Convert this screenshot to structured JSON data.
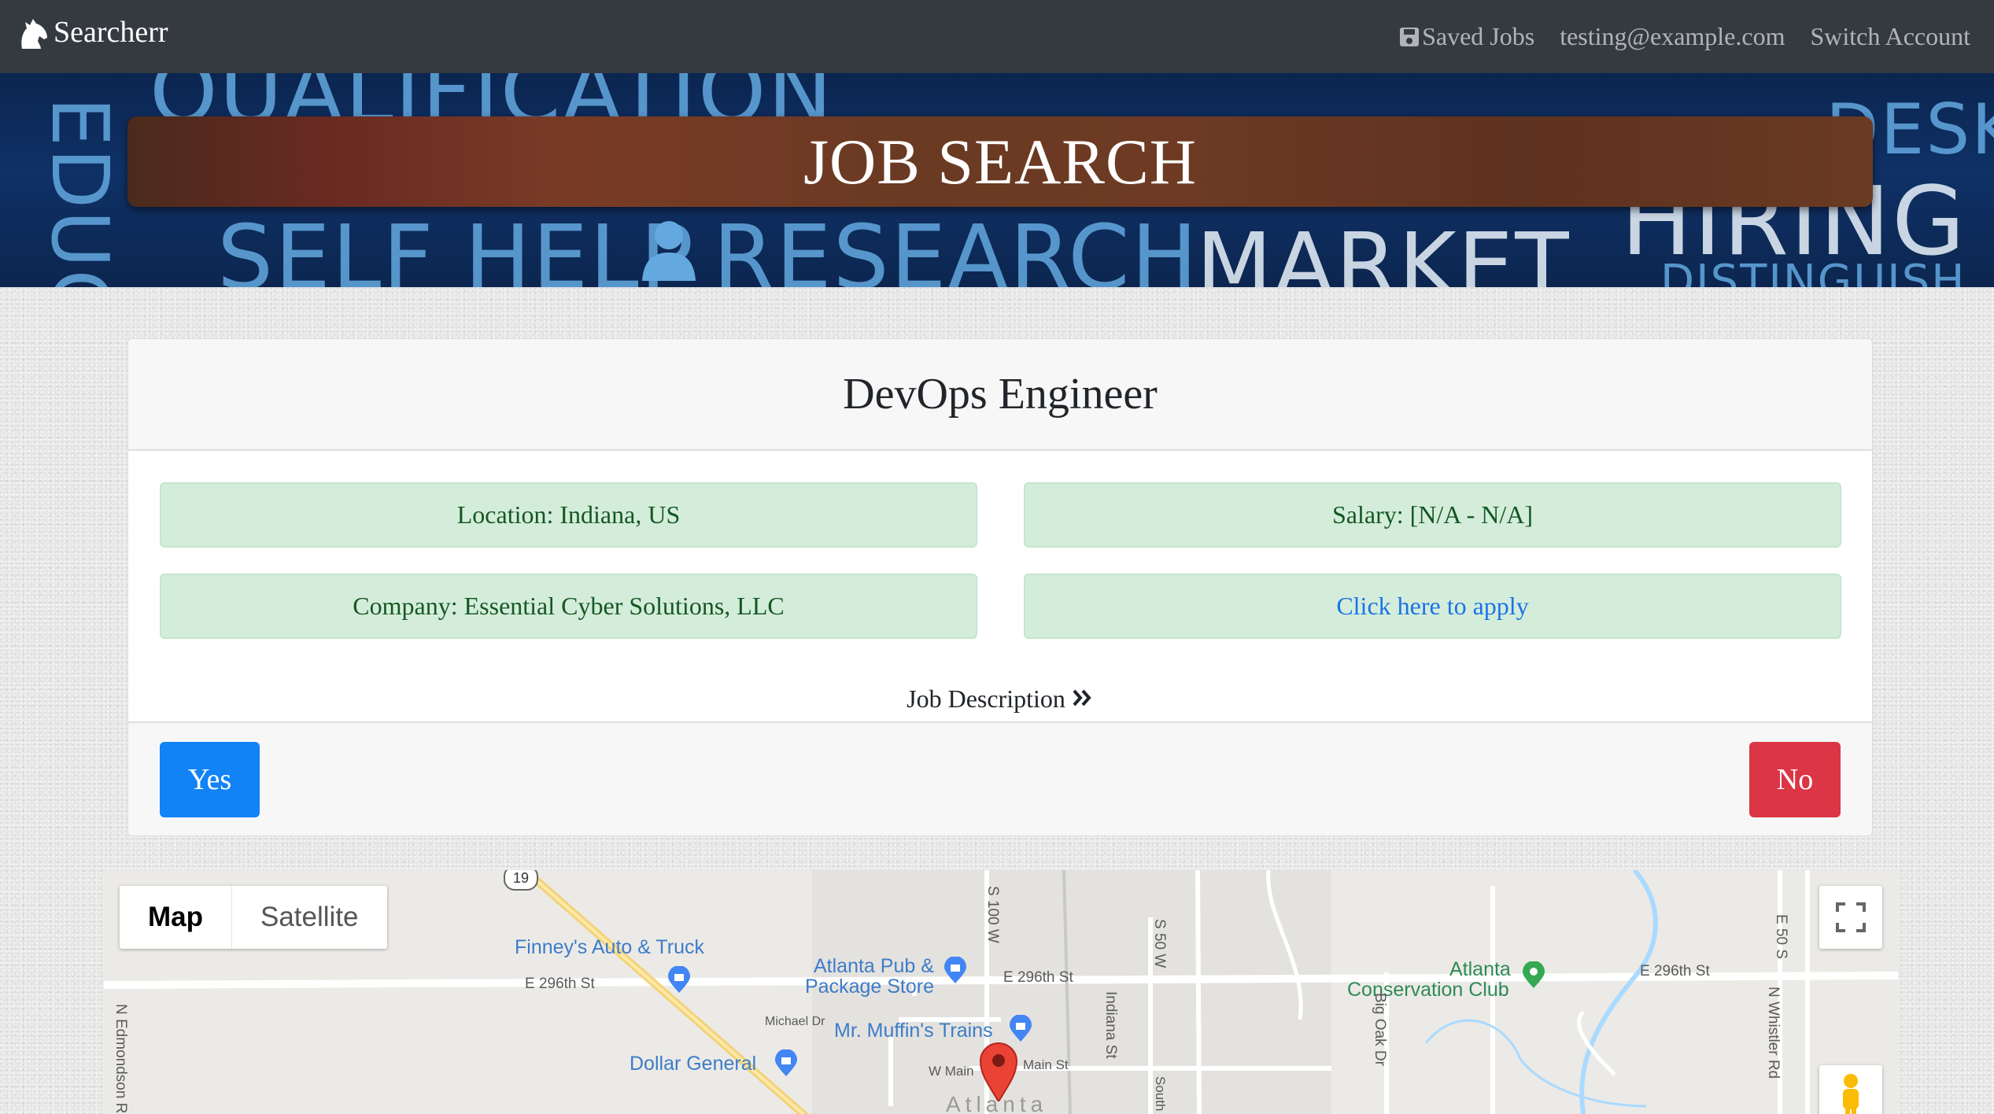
{
  "nav": {
    "brand": "Searcherr",
    "saved_jobs": "Saved Jobs",
    "user_email": "testing@example.com",
    "switch_account": "Switch Account"
  },
  "banner": {
    "title": "JOB SEARCH",
    "bg_words": [
      "EDUC",
      "QUALIFICATION",
      "SELF HELP",
      "RESEARCH",
      "MARKET",
      "DESK",
      "HIRING",
      "DISTINGUISH"
    ]
  },
  "job": {
    "title": "DevOps Engineer",
    "location": "Location: Indiana, US",
    "salary": "Salary: [N/A - N/A]",
    "company": "Company: Essential Cyber Solutions, LLC",
    "apply_link": "Click here to apply",
    "description_toggle": "Job Description"
  },
  "actions": {
    "yes": "Yes",
    "no": "No"
  },
  "map": {
    "map_label": "Map",
    "satellite_label": "Satellite",
    "route_shield": "19",
    "pois": {
      "finneys": "Finney's Auto & Truck",
      "atlanta_pub_1": "Atlanta Pub &",
      "atlanta_pub_2": "Package Store",
      "atlanta_conservation_1": "Atlanta",
      "atlanta_conservation_2": "Conservation Club",
      "muffins": "Mr. Muffin's Trains",
      "dollar_general": "Dollar General"
    },
    "streets": {
      "e296_a": "E 296th St",
      "e296_b": "E 296th St",
      "e296_c": "E 296th St",
      "s100w": "S 100 W",
      "s50w": "S 50 W",
      "e50s": "E 50 S",
      "michael": "Michael Dr",
      "indiana": "Indiana St",
      "bigoak": "Big Oak Dr",
      "nwhistler": "N Whistler Rd",
      "nedmondson": "N Edmondson Rd",
      "wmain": "W Main",
      "mainst": "Main St",
      "south": "South",
      "town": "Atlanta"
    }
  },
  "colors": {
    "navbar": "#343a40",
    "success_bg": "#d4edda",
    "success_text": "#155724",
    "primary": "#1183f7",
    "danger": "#dc3545"
  }
}
